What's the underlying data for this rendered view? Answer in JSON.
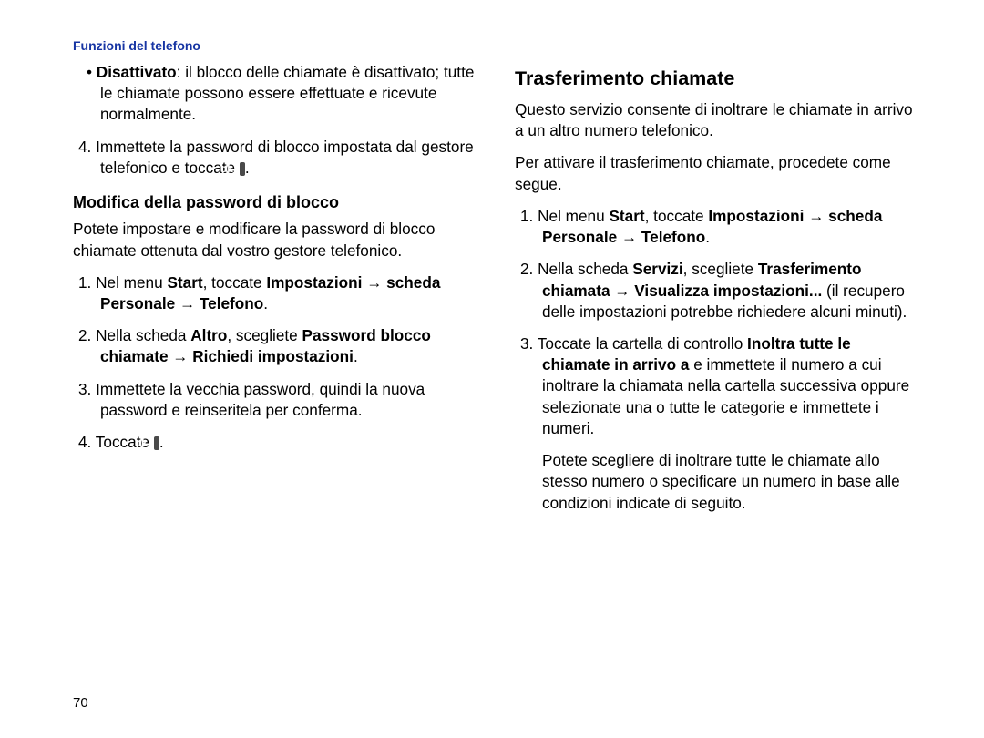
{
  "header": "Funzioni del telefono",
  "page_number": "70",
  "left": {
    "bullet_label": "Disattivato",
    "bullet_text": ": il blocco delle chiamate è disattivato; tutte le chiamate possono essere effettuate e ricevute normalmente.",
    "step4a": "4. Immettete la password di blocco impostata dal gestore telefonico e toccate ",
    "step4b": ".",
    "subsection": "Modifica della password di blocco",
    "intro": "Potete impostare e modificare la password di blocco chiamate ottenuta dal vostro gestore telefonico.",
    "s1a": "1. Nel menu ",
    "s1b": "Start",
    "s1c": ", toccate ",
    "s1d": "Impostazioni",
    "s1e": " → scheda ",
    "s1f": "Personale",
    "s1g": " → ",
    "s1h": "Telefono",
    "s1i": ".",
    "s2a": "2. Nella scheda ",
    "s2b": "Altro",
    "s2c": ", scegliete ",
    "s2d": "Password blocco chiamate",
    "s2e": " → ",
    "s2f": "Richiedi impostazioni",
    "s2g": ".",
    "s3": "3. Immettete la vecchia password, quindi la nuova password e reinseritela per conferma.",
    "s4a": "4. Toccate ",
    "s4b": "."
  },
  "right": {
    "title": "Trasferimento chiamate",
    "intro": "Questo servizio consente di inoltrare le chiamate in arrivo a un altro numero telefonico.",
    "intro2": "Per attivare il trasferimento chiamate, procedete come segue.",
    "s1a": "1. Nel menu ",
    "s1b": "Start",
    "s1c": ", toccate ",
    "s1d": "Impostazioni",
    "s1e": " → scheda ",
    "s1f": "Personale",
    "s1g": " → ",
    "s1h": "Telefono",
    "s1i": ".",
    "s2a": "2. Nella scheda ",
    "s2b": "Servizi",
    "s2c": ", scegliete ",
    "s2d": "Trasferimento chiamata",
    "s2e": " → ",
    "s2f": "Visualizza impostazioni...",
    "s2g": " (il recupero delle impostazioni potrebbe richiedere alcuni minuti).",
    "s3a": "3. Toccate la cartella di controllo ",
    "s3b": "Inoltra tutte le chiamate in arrivo a",
    "s3c": " e immettete il numero a cui inoltrare la chiamata nella cartella successiva oppure selezionate una o tutte le categorie e immettete i numeri.",
    "s3p": "Potete scegliere di inoltrare tutte le chiamate allo stesso numero o specificare un numero in base alle condizioni indicate di seguito."
  },
  "ok_label": "ok"
}
